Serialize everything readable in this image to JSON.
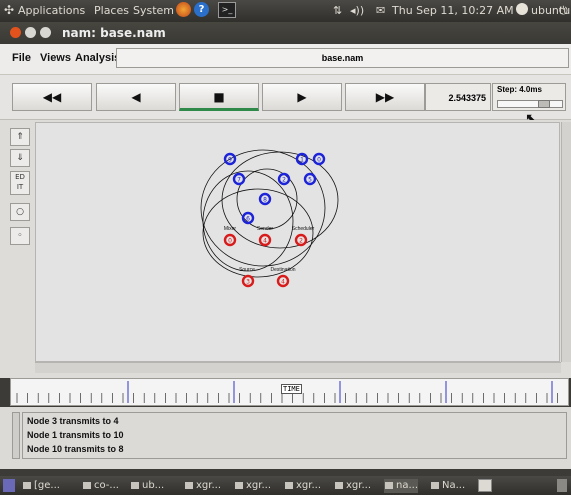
{
  "top_panel": {
    "menus": [
      "Applications",
      "Places",
      "System"
    ],
    "clock": "Thu Sep 11, 10:27 AM",
    "user": "ubuntu"
  },
  "window": {
    "title": "nam: base.nam"
  },
  "menubar": {
    "items": [
      "File",
      "Views",
      "Analysis"
    ],
    "filename": "base.nam"
  },
  "toolbar": {
    "rewind": "◀◀",
    "back": "◀",
    "stop": "■",
    "play": "▶",
    "fast_forward": "▶▶",
    "time": "2.543375",
    "step": "Step: 4.0ms"
  },
  "sidebar": {
    "edit_label": "ED IT"
  },
  "canvas": {
    "nodes_blue": [
      "9",
      "7",
      "1",
      "0",
      "2",
      "5",
      "8",
      "6"
    ],
    "nodes_red": [
      "0",
      "4",
      "2",
      "3",
      "4"
    ],
    "labels": [
      "Mixer",
      "Sender",
      "Scheduler",
      "Source",
      "Destination"
    ]
  },
  "timeline": {
    "marker": "TIME"
  },
  "annotations": [
    "Node 3 transmits to 4",
    "Node 1 transmits to 10",
    "Node 10 transmits to 8"
  ],
  "taskbar": {
    "tasks": [
      "[ge...",
      "co-...",
      "ub...",
      "xgr...",
      "xgr...",
      "xgr...",
      "xgr...",
      "na...",
      "Na..."
    ]
  },
  "colors": {
    "node_blue": "#1c23d8",
    "node_red": "#d81c1c",
    "progress_green": "#2f8a4a"
  }
}
